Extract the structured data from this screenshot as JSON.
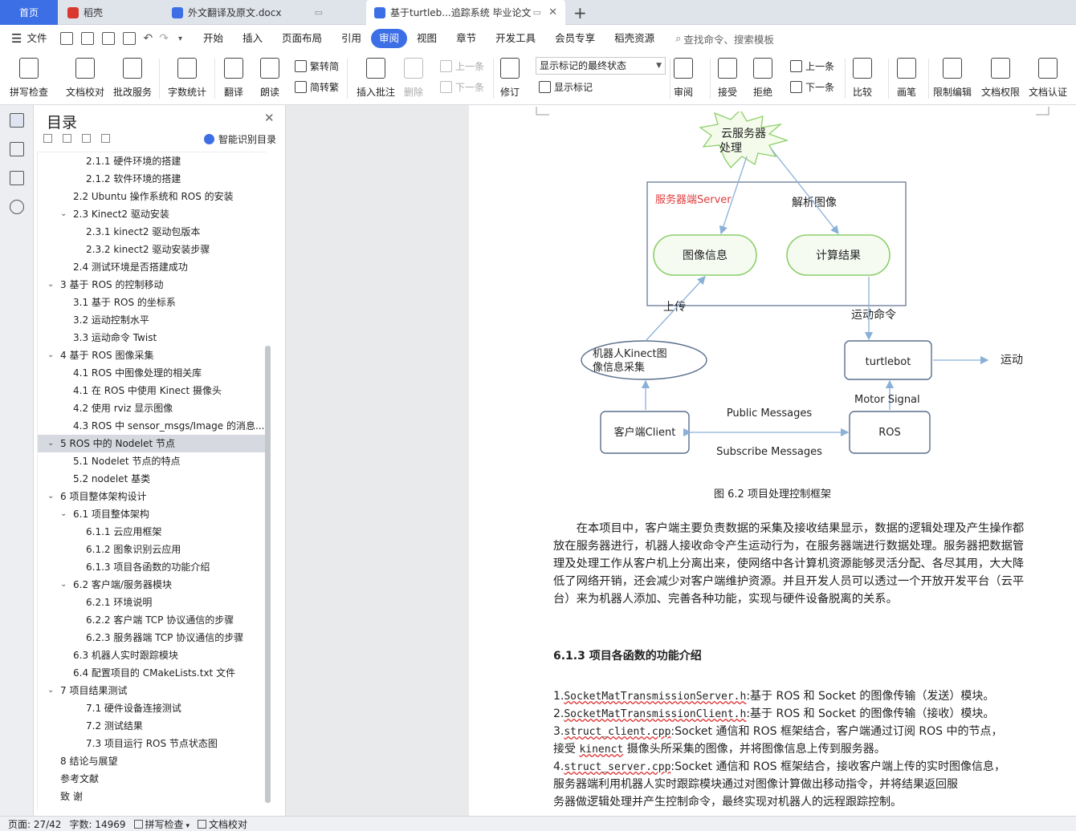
{
  "tabs": [
    {
      "label": "首页"
    },
    {
      "label": "稻壳"
    },
    {
      "label": "外文翻译及原文.docx"
    },
    {
      "label": "基于turtleb...追踪系统 毕业论文"
    }
  ],
  "brand_color": "#3c6ee5",
  "menu": {
    "file": "文件",
    "items": [
      "开始",
      "插入",
      "页面布局",
      "引用",
      "审阅",
      "视图",
      "章节",
      "开发工具",
      "会员专享",
      "稻壳资源"
    ],
    "active": "审阅",
    "search_placeholder": "查找命令、搜索模板"
  },
  "ribbon": {
    "spell": "拼写检查",
    "proof": "文档校对",
    "batch": "批改服务",
    "wordcount": "字数统计",
    "translate": "翻译",
    "read": "朗读",
    "trad": "繁转简",
    "simp": "简转繁",
    "insert_comment": "插入批注",
    "delete": "删除",
    "prev": "上一条",
    "next": "下一条",
    "revise": "修订",
    "show_mark": "显示标记",
    "mark_state": "显示标记的最终状态",
    "review": "审阅",
    "accept": "接受",
    "reject": "拒绝",
    "prev2": "上一条",
    "next2": "下一条",
    "compare": "比较",
    "pen": "画笔",
    "limit_edit": "限制编辑",
    "doc_perm": "文档权限",
    "doc_cert": "文档认证"
  },
  "nav": {
    "title": "目录",
    "smart": "智能识别目录",
    "toc": [
      {
        "label": "2.1.1 硬件环境的搭建",
        "level": 3
      },
      {
        "label": "2.1.2 软件环境的搭建",
        "level": 3
      },
      {
        "label": "2.2 Ubuntu 操作系统和 ROS 的安装",
        "level": 2
      },
      {
        "label": "2.3 Kinect2 驱动安装",
        "level": 2,
        "toggle": true
      },
      {
        "label": "2.3.1 kinect2 驱动包版本",
        "level": 3
      },
      {
        "label": "2.3.2 kinect2 驱动安装步骤",
        "level": 3
      },
      {
        "label": "2.4 测试环境是否搭建成功",
        "level": 2
      },
      {
        "label": "3   基于 ROS 的控制移动",
        "level": 1,
        "toggle": true
      },
      {
        "label": "3.1  基于 ROS 的坐标系",
        "level": 2
      },
      {
        "label": "3.2  运动控制水平",
        "level": 2
      },
      {
        "label": "3.3 运动命令 Twist",
        "level": 2
      },
      {
        "label": "4   基于 ROS 图像采集",
        "level": 1,
        "toggle": true
      },
      {
        "label": "4.1 ROS 中图像处理的相关库",
        "level": 2
      },
      {
        "label": "4.1  在 ROS 中使用 Kinect 摄像头",
        "level": 2
      },
      {
        "label": "4.2  使用 rviz 显示图像",
        "level": 2
      },
      {
        "label": "4.3 ROS 中 sensor_msgs/Image 的消息...",
        "level": 2
      },
      {
        "label": "5   ROS 中的 Nodelet 节点",
        "level": 1,
        "toggle": true,
        "selected": true
      },
      {
        "label": "5.1 Nodelet 节点的特点",
        "level": 2
      },
      {
        "label": "5.2 nodelet 基类",
        "level": 2
      },
      {
        "label": "6   项目整体架构设计",
        "level": 1,
        "toggle": true
      },
      {
        "label": "6.1  项目整体架构",
        "level": 2,
        "toggle": true
      },
      {
        "label": "6.1.1  云应用框架",
        "level": 3
      },
      {
        "label": "6.1.2  图象识别云应用",
        "level": 3
      },
      {
        "label": "6.1.3  项目各函数的功能介绍",
        "level": 3
      },
      {
        "label": "6.2  客户端/服务器模块",
        "level": 2,
        "toggle": true
      },
      {
        "label": "6.2.1 环境说明",
        "level": 3
      },
      {
        "label": "6.2.2 客户端 TCP 协议通信的步骤",
        "level": 3
      },
      {
        "label": "6.2.3 服务器端 TCP 协议通信的步骤",
        "level": 3
      },
      {
        "label": "6.3  机器人实时跟踪模块",
        "level": 2
      },
      {
        "label": "6.4  配置项目的 CMakeLists.txt 文件",
        "level": 2
      },
      {
        "label": "7   项目结果测试",
        "level": 1,
        "toggle": true
      },
      {
        "label": "7.1 硬件设备连接测试",
        "level": 3
      },
      {
        "label": "7.2 测试结果",
        "level": 3
      },
      {
        "label": "7.3 项目运行 ROS 节点状态图",
        "level": 3
      },
      {
        "label": "8   结论与展望",
        "level": 1
      },
      {
        "label": "参考文献",
        "level": 0
      },
      {
        "label": "致  谢",
        "level": 0
      }
    ]
  },
  "diagram": {
    "cloud": [
      "云服务器",
      "处理"
    ],
    "server_label": "服务器端Server",
    "parse": "解析图像",
    "image_info": "图像信息",
    "compute": "计算结果",
    "upload": "上传",
    "motion_cmd": "运动命令",
    "robot": [
      "机器人Kinect图",
      "像信息采集"
    ],
    "turtlebot": "turtlebot",
    "motion": "运动",
    "motor": "Motor  Signal",
    "client": "客户端Client",
    "ros": "ROS",
    "public": "Public Messages",
    "subscribe": "Subscribe Messages",
    "caption": "图 6.2 项目处理控制框架"
  },
  "doc": {
    "para": "在本项目中，客户端主要负责数据的采集及接收结果显示，数据的逻辑处理及产生操作都放在服务器进行，机器人接收命令产生运动行为，在服务器端进行数据处理。服务器把数据管理及处理工作从客户机上分离出来，使网络中各计算机资源能够灵活分配、各尽其用，大大降低了网络开销，还会减少对客户端维护资源。并且开发人员可以透过一个开放开发平台（云平台）来为机器人添加、完善各种功能，实现与硬件设备脱离的关系。",
    "heading": "6.1.3  项目各函数的功能介绍",
    "lines": [
      {
        "pre": "1.",
        "code": "SocketMatTransmissionServer.h",
        "post": ":基于 ROS 和 Socket 的图像传输（发送）模块。"
      },
      {
        "pre": "2.",
        "code": "SocketMatTransmissionClient.h",
        "post": ":基于 ROS 和 Socket 的图像传输（接收）模块。"
      },
      {
        "pre": "3.",
        "code": "struct_client.cpp",
        "post": ":Socket 通信和 ROS 框架结合，客户端通过订阅 ROS 中的节点，"
      },
      {
        "pre": "接受 ",
        "code": "kinenct",
        "post": " 摄像头所采集的图像，并将图像信息上传到服务器。"
      },
      {
        "pre": "4.",
        "code": "struct_server.cpp",
        "post": ":Socket 通信和 ROS 框架结合，接收客户端上传的实时图像信息，"
      },
      {
        "pre": "",
        "code": "",
        "post": "服务器端利用机器人实时跟踪模块通过对图像计算做出移动指令，并将结果返回服"
      },
      {
        "pre": "",
        "code": "",
        "post": "务器做逻辑处理并产生控制命令，最终实现对机器人的远程跟踪控制。"
      }
    ]
  },
  "status": {
    "page": "页面: 27/42",
    "words": "字数: 14969",
    "spell": "拼写检查",
    "proof": "文档校对"
  }
}
